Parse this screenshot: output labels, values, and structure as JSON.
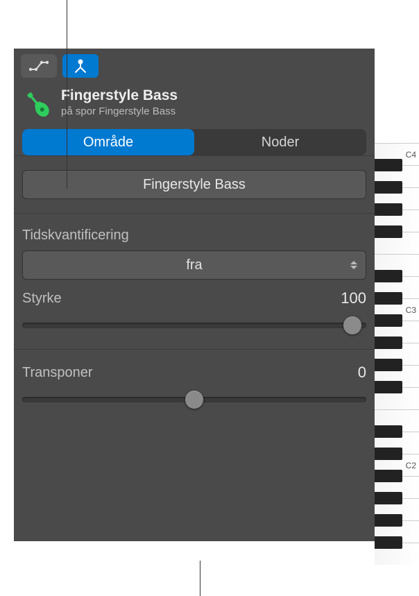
{
  "header": {
    "title": "Fingerstyle Bass",
    "subtitle": "på spor Fingerstyle Bass"
  },
  "tabs": {
    "region_label": "Område",
    "notes_label": "Noder"
  },
  "region": {
    "name": "Fingerstyle Bass",
    "quantize_label": "Tidskvantificering",
    "quantize_value": "fra",
    "velocity_label": "Styrke",
    "velocity_value": "100",
    "velocity_pos_pct": 96,
    "transpose_label": "Transponer",
    "transpose_value": "0",
    "transpose_pos_pct": 50
  },
  "piano": {
    "labels": [
      "C4",
      "C3",
      "C2"
    ]
  },
  "colors": {
    "accent": "#0079d1",
    "panel": "#4a4a4a",
    "guitar": "#2fcc5e"
  }
}
